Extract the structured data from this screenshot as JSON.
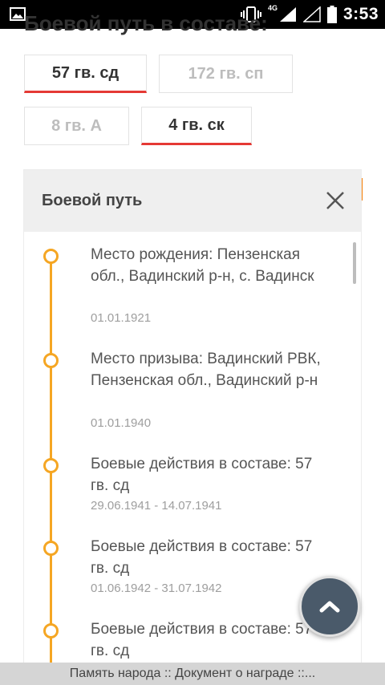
{
  "status_bar": {
    "network": "4G",
    "time": "3:53"
  },
  "page": {
    "title": "Боевой путь в составе:",
    "tabs": [
      {
        "label": "57 гв. сд",
        "active": true
      },
      {
        "label": "172 гв. сп",
        "active": false
      },
      {
        "label": "8 гв. А",
        "active": false
      },
      {
        "label": "4 гв. ск",
        "active": true
      }
    ]
  },
  "modal": {
    "title": "Боевой путь",
    "events": [
      {
        "text": "Место рождения: Пензенская обл., Вадинский р-н, с. Вадинск",
        "date": "01.01.1921"
      },
      {
        "text": "Место призыва: Вадинский РВК, Пензенская обл., Вадинский р-н",
        "date": "01.01.1940"
      },
      {
        "text": "Боевые действия в составе: 57 гв. сд",
        "date": "29.06.1941 - 14.07.1941"
      },
      {
        "text": "Боевые действия в составе: 57 гв. сд",
        "date": "01.06.1942 - 31.07.1942"
      },
      {
        "text": "Боевые действия в составе: 57 гв. сд",
        "date": ""
      }
    ]
  },
  "bottom_bar": {
    "text": "Память народа :: Документ о награде ::..."
  },
  "colors": {
    "accent_red": "#e53935",
    "timeline_orange": "#f5a623",
    "fab": "#4a5a6a"
  }
}
